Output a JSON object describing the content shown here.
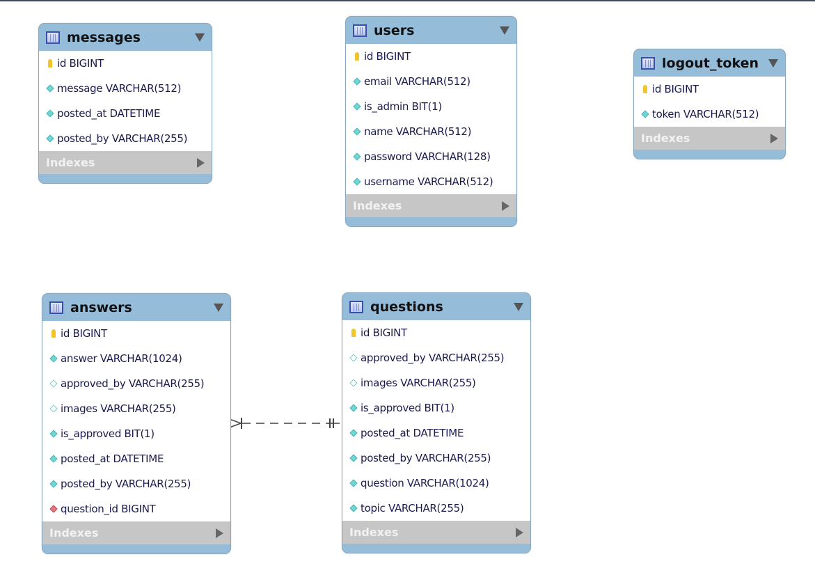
{
  "indexes_label": "Indexes",
  "tables": [
    {
      "id": "messages",
      "name": "messages",
      "columns": [
        {
          "text": "id BIGINT",
          "icon": "key"
        },
        {
          "text": "message VARCHAR(512)",
          "icon": "nn"
        },
        {
          "text": "posted_at DATETIME",
          "icon": "nn"
        },
        {
          "text": "posted_by VARCHAR(255)",
          "icon": "nn"
        }
      ]
    },
    {
      "id": "users",
      "name": "users",
      "columns": [
        {
          "text": "id BIGINT",
          "icon": "key"
        },
        {
          "text": "email VARCHAR(512)",
          "icon": "nn"
        },
        {
          "text": "is_admin BIT(1)",
          "icon": "nn"
        },
        {
          "text": "name VARCHAR(512)",
          "icon": "nn"
        },
        {
          "text": "password VARCHAR(128)",
          "icon": "nn"
        },
        {
          "text": "username VARCHAR(512)",
          "icon": "nn"
        }
      ]
    },
    {
      "id": "logout_token",
      "name": "logout_token",
      "columns": [
        {
          "text": "id BIGINT",
          "icon": "key"
        },
        {
          "text": "token VARCHAR(512)",
          "icon": "nn"
        }
      ]
    },
    {
      "id": "answers",
      "name": "answers",
      "columns": [
        {
          "text": "id BIGINT",
          "icon": "key"
        },
        {
          "text": "answer VARCHAR(1024)",
          "icon": "nn"
        },
        {
          "text": "approved_by VARCHAR(255)",
          "icon": "nl"
        },
        {
          "text": "images VARCHAR(255)",
          "icon": "nl"
        },
        {
          "text": "is_approved BIT(1)",
          "icon": "nn"
        },
        {
          "text": "posted_at DATETIME",
          "icon": "nn"
        },
        {
          "text": "posted_by VARCHAR(255)",
          "icon": "nn"
        },
        {
          "text": "question_id BIGINT",
          "icon": "fk"
        }
      ]
    },
    {
      "id": "questions",
      "name": "questions",
      "columns": [
        {
          "text": "id BIGINT",
          "icon": "key"
        },
        {
          "text": "approved_by VARCHAR(255)",
          "icon": "nl"
        },
        {
          "text": "images VARCHAR(255)",
          "icon": "nl"
        },
        {
          "text": "is_approved BIT(1)",
          "icon": "nn"
        },
        {
          "text": "posted_at DATETIME",
          "icon": "nn"
        },
        {
          "text": "posted_by VARCHAR(255)",
          "icon": "nn"
        },
        {
          "text": "question VARCHAR(1024)",
          "icon": "nn"
        },
        {
          "text": "topic VARCHAR(255)",
          "icon": "nn"
        }
      ]
    }
  ],
  "relationships": [
    {
      "from": "answers",
      "to": "questions",
      "type": "many-to-one",
      "identifying": false
    }
  ]
}
